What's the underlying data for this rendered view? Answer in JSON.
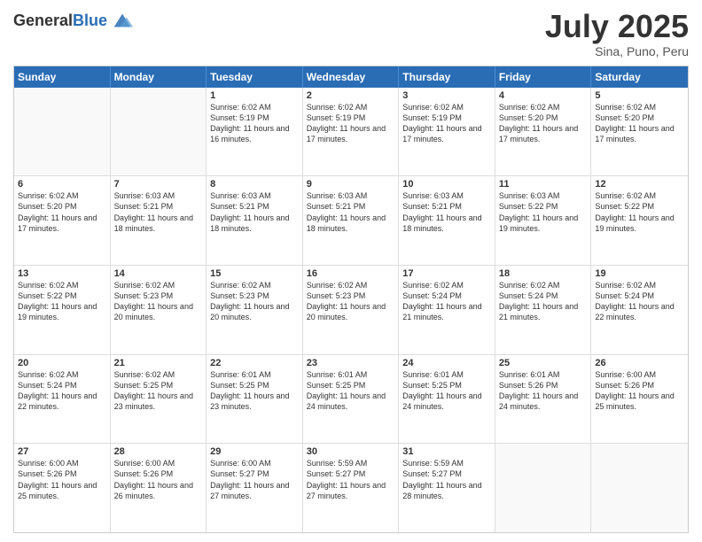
{
  "header": {
    "logo_general": "General",
    "logo_blue": "Blue",
    "title": "July 2025",
    "location": "Sina, Puno, Peru"
  },
  "calendar": {
    "days_of_week": [
      "Sunday",
      "Monday",
      "Tuesday",
      "Wednesday",
      "Thursday",
      "Friday",
      "Saturday"
    ],
    "weeks": [
      [
        {
          "day": "",
          "empty": true
        },
        {
          "day": "",
          "empty": true
        },
        {
          "day": "1",
          "line1": "Sunrise: 6:02 AM",
          "line2": "Sunset: 5:19 PM",
          "line3": "Daylight: 11 hours and 16 minutes."
        },
        {
          "day": "2",
          "line1": "Sunrise: 6:02 AM",
          "line2": "Sunset: 5:19 PM",
          "line3": "Daylight: 11 hours and 17 minutes."
        },
        {
          "day": "3",
          "line1": "Sunrise: 6:02 AM",
          "line2": "Sunset: 5:19 PM",
          "line3": "Daylight: 11 hours and 17 minutes."
        },
        {
          "day": "4",
          "line1": "Sunrise: 6:02 AM",
          "line2": "Sunset: 5:20 PM",
          "line3": "Daylight: 11 hours and 17 minutes."
        },
        {
          "day": "5",
          "line1": "Sunrise: 6:02 AM",
          "line2": "Sunset: 5:20 PM",
          "line3": "Daylight: 11 hours and 17 minutes."
        }
      ],
      [
        {
          "day": "6",
          "line1": "Sunrise: 6:02 AM",
          "line2": "Sunset: 5:20 PM",
          "line3": "Daylight: 11 hours and 17 minutes."
        },
        {
          "day": "7",
          "line1": "Sunrise: 6:03 AM",
          "line2": "Sunset: 5:21 PM",
          "line3": "Daylight: 11 hours and 18 minutes."
        },
        {
          "day": "8",
          "line1": "Sunrise: 6:03 AM",
          "line2": "Sunset: 5:21 PM",
          "line3": "Daylight: 11 hours and 18 minutes."
        },
        {
          "day": "9",
          "line1": "Sunrise: 6:03 AM",
          "line2": "Sunset: 5:21 PM",
          "line3": "Daylight: 11 hours and 18 minutes."
        },
        {
          "day": "10",
          "line1": "Sunrise: 6:03 AM",
          "line2": "Sunset: 5:21 PM",
          "line3": "Daylight: 11 hours and 18 minutes."
        },
        {
          "day": "11",
          "line1": "Sunrise: 6:03 AM",
          "line2": "Sunset: 5:22 PM",
          "line3": "Daylight: 11 hours and 19 minutes."
        },
        {
          "day": "12",
          "line1": "Sunrise: 6:02 AM",
          "line2": "Sunset: 5:22 PM",
          "line3": "Daylight: 11 hours and 19 minutes."
        }
      ],
      [
        {
          "day": "13",
          "line1": "Sunrise: 6:02 AM",
          "line2": "Sunset: 5:22 PM",
          "line3": "Daylight: 11 hours and 19 minutes."
        },
        {
          "day": "14",
          "line1": "Sunrise: 6:02 AM",
          "line2": "Sunset: 5:23 PM",
          "line3": "Daylight: 11 hours and 20 minutes."
        },
        {
          "day": "15",
          "line1": "Sunrise: 6:02 AM",
          "line2": "Sunset: 5:23 PM",
          "line3": "Daylight: 11 hours and 20 minutes."
        },
        {
          "day": "16",
          "line1": "Sunrise: 6:02 AM",
          "line2": "Sunset: 5:23 PM",
          "line3": "Daylight: 11 hours and 20 minutes."
        },
        {
          "day": "17",
          "line1": "Sunrise: 6:02 AM",
          "line2": "Sunset: 5:24 PM",
          "line3": "Daylight: 11 hours and 21 minutes."
        },
        {
          "day": "18",
          "line1": "Sunrise: 6:02 AM",
          "line2": "Sunset: 5:24 PM",
          "line3": "Daylight: 11 hours and 21 minutes."
        },
        {
          "day": "19",
          "line1": "Sunrise: 6:02 AM",
          "line2": "Sunset: 5:24 PM",
          "line3": "Daylight: 11 hours and 22 minutes."
        }
      ],
      [
        {
          "day": "20",
          "line1": "Sunrise: 6:02 AM",
          "line2": "Sunset: 5:24 PM",
          "line3": "Daylight: 11 hours and 22 minutes."
        },
        {
          "day": "21",
          "line1": "Sunrise: 6:02 AM",
          "line2": "Sunset: 5:25 PM",
          "line3": "Daylight: 11 hours and 23 minutes."
        },
        {
          "day": "22",
          "line1": "Sunrise: 6:01 AM",
          "line2": "Sunset: 5:25 PM",
          "line3": "Daylight: 11 hours and 23 minutes."
        },
        {
          "day": "23",
          "line1": "Sunrise: 6:01 AM",
          "line2": "Sunset: 5:25 PM",
          "line3": "Daylight: 11 hours and 24 minutes."
        },
        {
          "day": "24",
          "line1": "Sunrise: 6:01 AM",
          "line2": "Sunset: 5:25 PM",
          "line3": "Daylight: 11 hours and 24 minutes."
        },
        {
          "day": "25",
          "line1": "Sunrise: 6:01 AM",
          "line2": "Sunset: 5:26 PM",
          "line3": "Daylight: 11 hours and 24 minutes."
        },
        {
          "day": "26",
          "line1": "Sunrise: 6:00 AM",
          "line2": "Sunset: 5:26 PM",
          "line3": "Daylight: 11 hours and 25 minutes."
        }
      ],
      [
        {
          "day": "27",
          "line1": "Sunrise: 6:00 AM",
          "line2": "Sunset: 5:26 PM",
          "line3": "Daylight: 11 hours and 25 minutes."
        },
        {
          "day": "28",
          "line1": "Sunrise: 6:00 AM",
          "line2": "Sunset: 5:26 PM",
          "line3": "Daylight: 11 hours and 26 minutes."
        },
        {
          "day": "29",
          "line1": "Sunrise: 6:00 AM",
          "line2": "Sunset: 5:27 PM",
          "line3": "Daylight: 11 hours and 27 minutes."
        },
        {
          "day": "30",
          "line1": "Sunrise: 5:59 AM",
          "line2": "Sunset: 5:27 PM",
          "line3": "Daylight: 11 hours and 27 minutes."
        },
        {
          "day": "31",
          "line1": "Sunrise: 5:59 AM",
          "line2": "Sunset: 5:27 PM",
          "line3": "Daylight: 11 hours and 28 minutes."
        },
        {
          "day": "",
          "empty": true
        },
        {
          "day": "",
          "empty": true
        }
      ]
    ]
  }
}
